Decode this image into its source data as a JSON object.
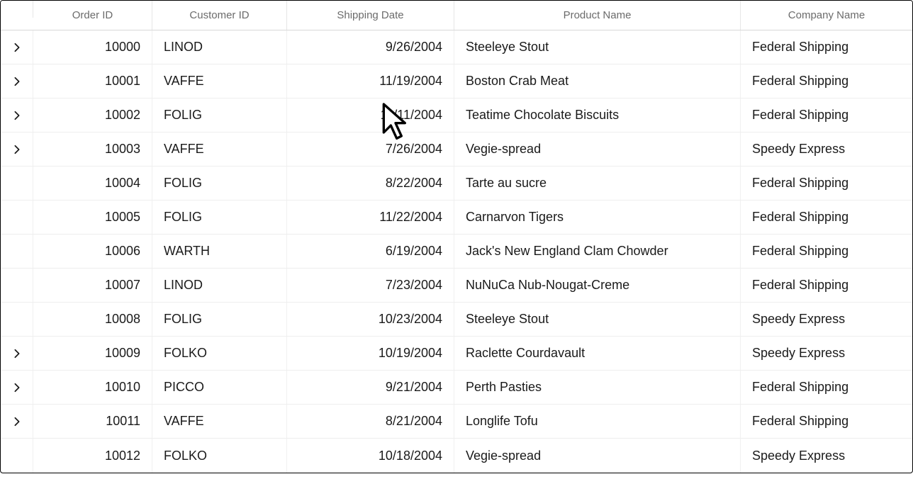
{
  "columns": {
    "expand": "",
    "orderid": "Order ID",
    "customerid": "Customer ID",
    "shipdate": "Shipping Date",
    "product": "Product Name",
    "company": "Company Name"
  },
  "rows": [
    {
      "expandable": true,
      "orderid": "10000",
      "customerid": "LINOD",
      "shipdate": "9/26/2004",
      "product": "Steeleye Stout",
      "company": "Federal Shipping"
    },
    {
      "expandable": true,
      "orderid": "10001",
      "customerid": "VAFFE",
      "shipdate": "11/19/2004",
      "product": "Boston Crab Meat",
      "company": "Federal Shipping"
    },
    {
      "expandable": true,
      "orderid": "10002",
      "customerid": "FOLIG",
      "shipdate": "11/11/2004",
      "product": "Teatime Chocolate Biscuits",
      "company": "Federal Shipping"
    },
    {
      "expandable": true,
      "orderid": "10003",
      "customerid": "VAFFE",
      "shipdate": "7/26/2004",
      "product": "Vegie-spread",
      "company": "Speedy Express"
    },
    {
      "expandable": false,
      "orderid": "10004",
      "customerid": "FOLIG",
      "shipdate": "8/22/2004",
      "product": "Tarte au sucre",
      "company": "Federal Shipping"
    },
    {
      "expandable": false,
      "orderid": "10005",
      "customerid": "FOLIG",
      "shipdate": "11/22/2004",
      "product": "Carnarvon Tigers",
      "company": "Federal Shipping"
    },
    {
      "expandable": false,
      "orderid": "10006",
      "customerid": "WARTH",
      "shipdate": "6/19/2004",
      "product": "Jack's New England Clam Chowder",
      "company": "Federal Shipping"
    },
    {
      "expandable": false,
      "orderid": "10007",
      "customerid": "LINOD",
      "shipdate": "7/23/2004",
      "product": "NuNuCa Nub-Nougat-Creme",
      "company": "Federal Shipping"
    },
    {
      "expandable": false,
      "orderid": "10008",
      "customerid": "FOLIG",
      "shipdate": "10/23/2004",
      "product": "Steeleye Stout",
      "company": "Speedy Express"
    },
    {
      "expandable": true,
      "orderid": "10009",
      "customerid": "FOLKO",
      "shipdate": "10/19/2004",
      "product": "Raclette Courdavault",
      "company": "Speedy Express"
    },
    {
      "expandable": true,
      "orderid": "10010",
      "customerid": "PICCO",
      "shipdate": "9/21/2004",
      "product": "Perth Pasties",
      "company": "Federal Shipping"
    },
    {
      "expandable": true,
      "orderid": "10011",
      "customerid": "VAFFE",
      "shipdate": "8/21/2004",
      "product": "Longlife Tofu",
      "company": "Federal Shipping"
    },
    {
      "expandable": false,
      "orderid": "10012",
      "customerid": "FOLKO",
      "shipdate": "10/18/2004",
      "product": "Vegie-spread",
      "company": "Speedy Express"
    }
  ]
}
